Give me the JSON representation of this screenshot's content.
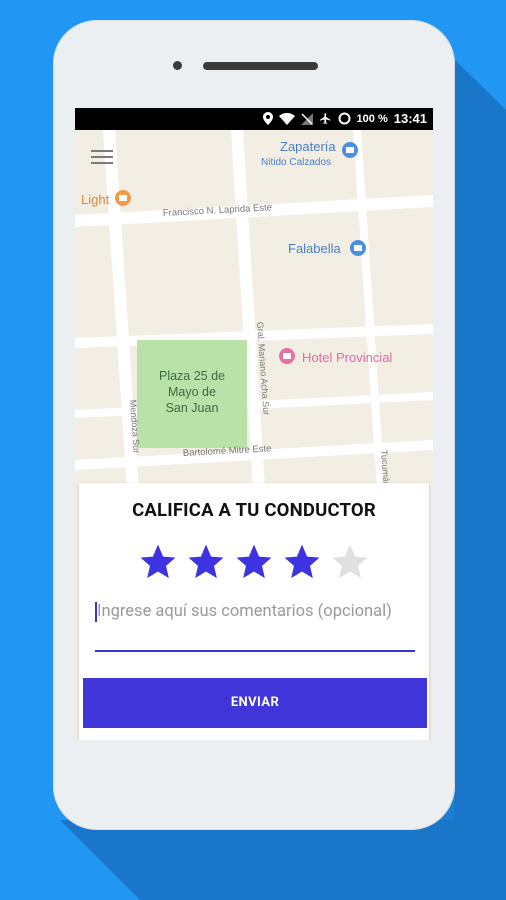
{
  "status_bar": {
    "battery": "100 %",
    "time": "13:41"
  },
  "map": {
    "places": {
      "zapateria_line1": "Zapatería",
      "zapateria_line2": "Nitido Calzados",
      "light": "Light",
      "falabella": "Falabella",
      "hotel": "Hotel Provincial",
      "plaza_line1": "Plaza 25 de",
      "plaza_line2": "Mayo de",
      "plaza_line3": "San Juan"
    },
    "streets": {
      "laprida": "Francisco N. Laprida Este",
      "acha": "Gral. Mariano Acha Sur",
      "mendoza": "Mendoza Sur",
      "mitre": "Bartolomé Mitre Este",
      "tucuman": "Tucumán"
    }
  },
  "rating": {
    "title": "CALIFICA A TU CONDUCTOR",
    "value": 4,
    "max": 5,
    "comment_placeholder": "Ingrese aquí sus comentarios (opcional)",
    "submit_label": "ENVIAR"
  },
  "colors": {
    "accent": "#3f35d9",
    "star_on": "#3b34e0",
    "star_off": "#e0e0e0",
    "background": "#2196f3"
  }
}
